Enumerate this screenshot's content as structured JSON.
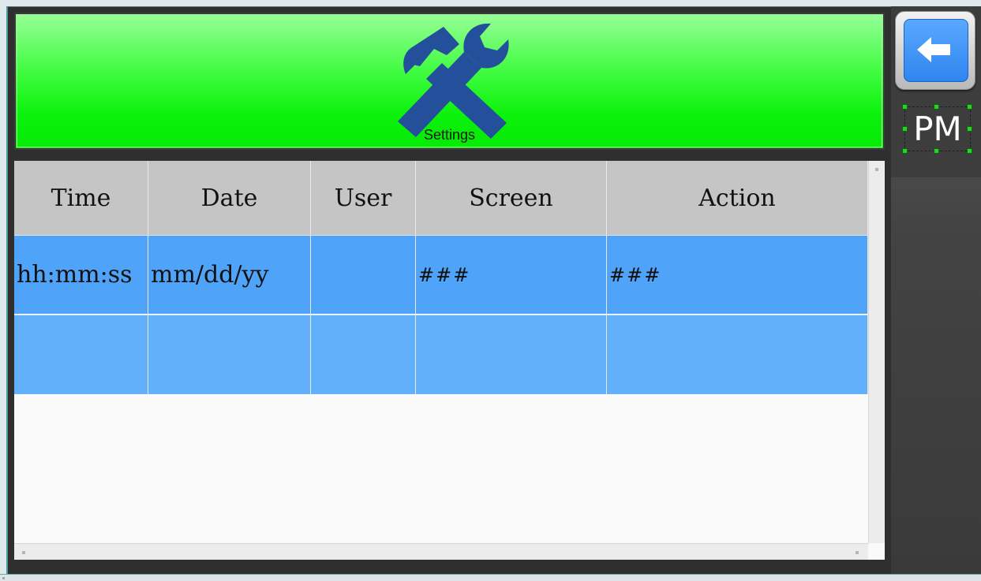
{
  "header": {
    "title": "Settings",
    "icon": "hammer-wrench-icon",
    "background_color": "#0cf20c",
    "icon_color": "#244f9b"
  },
  "sidebar": {
    "back_button": {
      "icon": "arrow-left-icon",
      "color": "#2f86f0"
    },
    "meridiem": "PM"
  },
  "table": {
    "columns": [
      "Time",
      "Date",
      "User",
      "Screen",
      "Action"
    ],
    "rows": [
      {
        "time": "hh:mm:ss",
        "date": "mm/dd/yy",
        "user": "",
        "screen": "###",
        "action": "###"
      },
      {
        "time": "",
        "date": "",
        "user": "",
        "screen": "",
        "action": ""
      }
    ],
    "header_color": "#c5c5c5",
    "selected_row_color": "#4fa4f9",
    "row_color": "#62b0fb"
  }
}
